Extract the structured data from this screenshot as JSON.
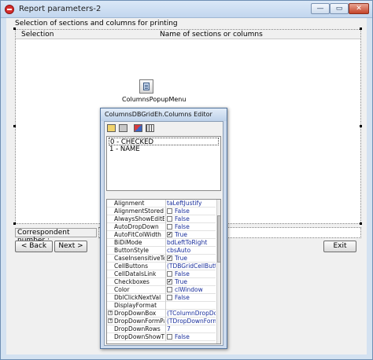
{
  "window": {
    "title": "Report parameters-2",
    "min_glyph": "—",
    "max_glyph": "▭",
    "close_glyph": "✕"
  },
  "main": {
    "section_caption": "Selection of sections and columns for printing",
    "grid_columns": [
      "Selection",
      "Name of sections or columns"
    ],
    "component_label": "ColumnsPopupMenu",
    "correspondent_label": "Correspondent number :",
    "correspondent_value": "",
    "buttons": {
      "back": "< Back",
      "next": "Next >",
      "exit": "Exit"
    }
  },
  "editor": {
    "title": "ColumnsDBGridEh.Columns Editor",
    "toolbar_icons": [
      "add-column-icon",
      "add-all-fields-icon",
      "move-icon",
      "grid-icon"
    ],
    "columns": [
      "0 - CHECKED",
      "1 - NAME"
    ],
    "properties": [
      {
        "name": "Alignment",
        "value": "taLeftJustify"
      },
      {
        "name": "AlignmentStored",
        "value": "False",
        "checkbox": true,
        "checked": false
      },
      {
        "name": "AlwaysShowEditButton",
        "value": "False",
        "checkbox": true,
        "checked": false
      },
      {
        "name": "AutoDropDown",
        "value": "False",
        "checkbox": true,
        "checked": false
      },
      {
        "name": "AutoFitColWidth",
        "value": "True",
        "checkbox": true,
        "checked": true
      },
      {
        "name": "BiDiMode",
        "value": "bdLeftToRight"
      },
      {
        "name": "ButtonStyle",
        "value": "cbsAuto"
      },
      {
        "name": "CaseInsensitiveTextSearch",
        "value": "True",
        "checkbox": true,
        "checked": true
      },
      {
        "name": "CellButtons",
        "value": "(TDBGridCellButtons)"
      },
      {
        "name": "CellDataIsLink",
        "value": "False",
        "checkbox": true,
        "checked": false
      },
      {
        "name": "Checkboxes",
        "value": "True",
        "checkbox": true,
        "checked": true
      },
      {
        "name": "Color",
        "value": "clWindow",
        "checkbox": true,
        "checked": false
      },
      {
        "name": "DblClickNextVal",
        "value": "False",
        "checkbox": true,
        "checked": false
      },
      {
        "name": "DisplayFormat",
        "value": ""
      },
      {
        "name": "DropDownBox",
        "value": "(TColumnDropDownBox)",
        "expand": true
      },
      {
        "name": "DropDownFormParams",
        "value": "(TDropDownFormCallParams)",
        "expand": true
      },
      {
        "name": "DropDownRows",
        "value": "7"
      },
      {
        "name": "DropDownShowTitles",
        "value": "False",
        "checkbox": true,
        "checked": false
      }
    ]
  }
}
